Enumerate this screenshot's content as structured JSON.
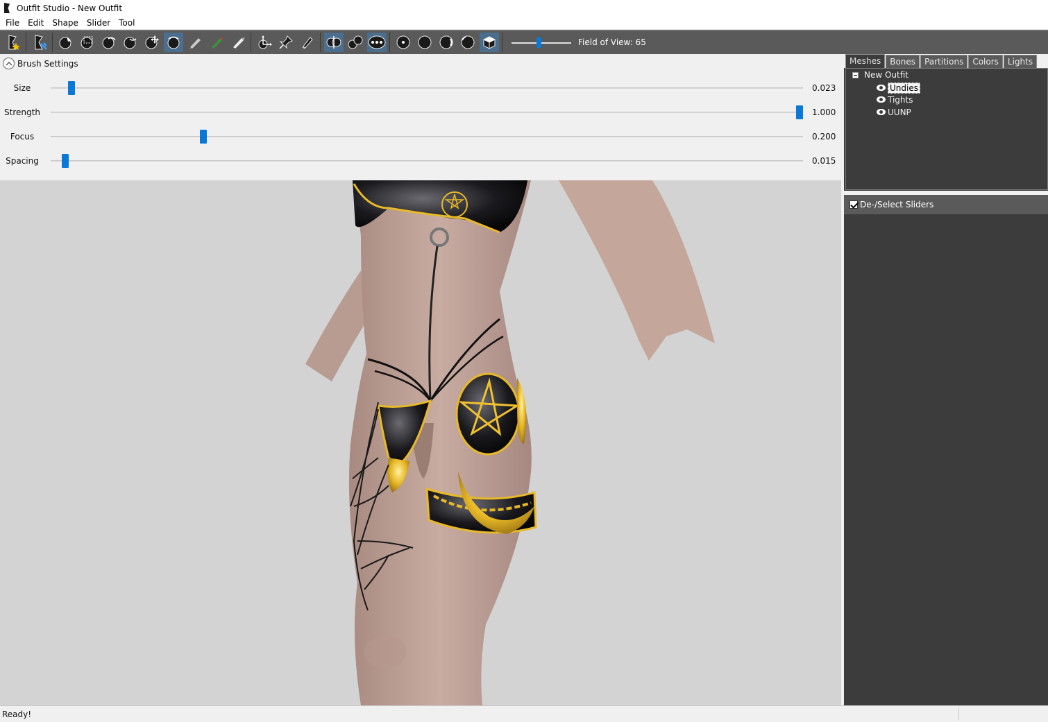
{
  "window": {
    "title": "Outfit Studio - New Outfit"
  },
  "menu": [
    "File",
    "Edit",
    "Shape",
    "Slider",
    "Tool"
  ],
  "toolbar": {
    "fov_label": "Field of View: 65",
    "fov_value": 65,
    "icons": [
      "load-project-icon",
      "save-project-icon",
      "select-brush-icon",
      "mask-brush-icon",
      "inflate-brush-icon",
      "deflate-brush-icon",
      "move-brush-icon",
      "smooth-brush-icon",
      "undiff-brush-icon",
      "weight-brush-icon",
      "color-brush-icon",
      "alpha-brush-icon",
      "transform-icon",
      "pivot-icon",
      "vertex-edit-icon",
      "x-mirror-icon",
      "connected-only-icon",
      "global-brush-icon",
      "show-vertices-icon",
      "show-wireframe-icon",
      "toggle-lighting-icon",
      "toggle-textures-icon",
      "toggle-cube-icon"
    ]
  },
  "brush": {
    "title": "Brush Settings",
    "rows": [
      {
        "label": "Size",
        "value": "0.023",
        "fraction": 0.023
      },
      {
        "label": "Strength",
        "value": "1.000",
        "fraction": 1.0
      },
      {
        "label": "Focus",
        "value": "0.200",
        "fraction": 0.2
      },
      {
        "label": "Spacing",
        "value": "0.015",
        "fraction": 0.015
      }
    ]
  },
  "tabs": [
    "Meshes",
    "Bones",
    "Partitions",
    "Colors",
    "Lights"
  ],
  "tree": {
    "root": "New Outfit",
    "children": [
      "Undies",
      "Tights",
      "UUNP"
    ]
  },
  "sliders": {
    "header": "De-/Select Sliders"
  },
  "status": {
    "text": "Ready!"
  },
  "colors": {
    "toolbar": "#5a5a5a",
    "panel": "#3c3c3c",
    "accent": "#0a78d7",
    "skin": "#c4a69a",
    "gold": "#e0b020"
  }
}
